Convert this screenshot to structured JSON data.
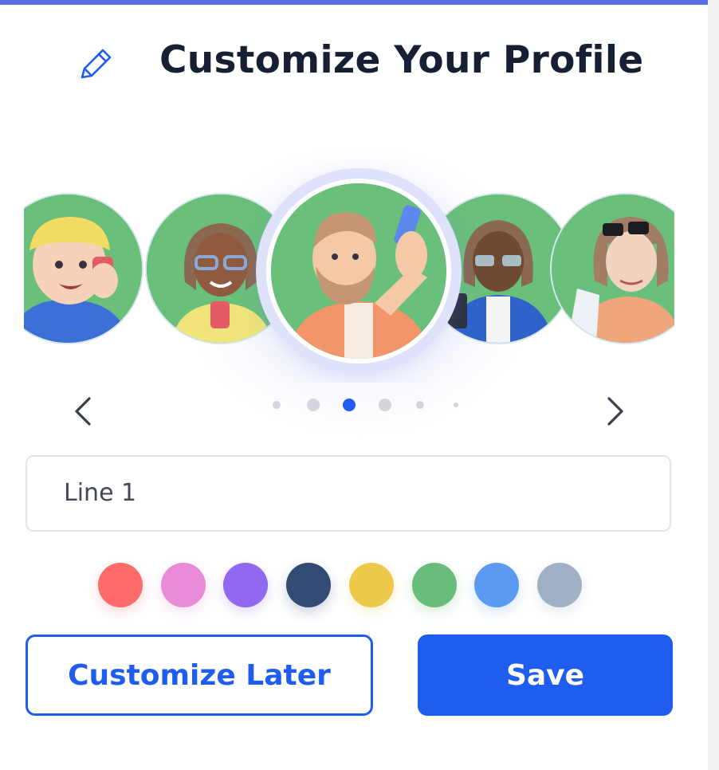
{
  "header": {
    "title": "Customize Your Profile",
    "icon": "pencil-icon"
  },
  "carousel": {
    "avatars": [
      {
        "name": "avatar-boy-cap-phone",
        "selected": false
      },
      {
        "name": "avatar-woman-glasses-phone",
        "selected": false
      },
      {
        "name": "avatar-bearded-man-selfie",
        "selected": true
      },
      {
        "name": "avatar-woman-tablet-blue-jacket",
        "selected": false
      },
      {
        "name": "avatar-woman-sunglasses",
        "selected": false
      }
    ],
    "prev_icon": "chevron-left-icon",
    "next_icon": "chevron-right-icon",
    "page_count": 6,
    "active_page": 3
  },
  "line_input": {
    "value": "Line 1"
  },
  "colors": [
    {
      "name": "red",
      "hex": "#ff6b6b"
    },
    {
      "name": "pink",
      "hex": "#e98bd8"
    },
    {
      "name": "purple",
      "hex": "#9168ef"
    },
    {
      "name": "navy",
      "hex": "#334a72"
    },
    {
      "name": "yellow",
      "hex": "#ecc94b"
    },
    {
      "name": "green",
      "hex": "#68bd7a"
    },
    {
      "name": "blue",
      "hex": "#5a9aef"
    },
    {
      "name": "gray",
      "hex": "#a0b0c5"
    }
  ],
  "buttons": {
    "later_label": "Customize Later",
    "save_label": "Save"
  },
  "theme": {
    "accent": "#1f5cf0",
    "top_bar": "#5b6ee8",
    "avatar_bg": "#6abf7b"
  }
}
